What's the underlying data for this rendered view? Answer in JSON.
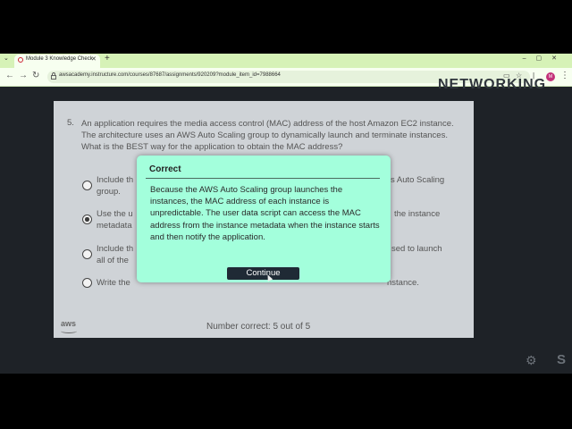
{
  "browser": {
    "tab_title": "Module 3 Knowledge Check",
    "url": "awsacademy.instructure.com/courses/87687/assignments/920209?module_item_id=7988664",
    "avatar_initials": "M",
    "icons": [
      "tab-menu-icon",
      "favicon-icon",
      "close-icon",
      "new-tab-icon",
      "minimize-icon",
      "maximize-icon",
      "window-close-icon",
      "back-icon",
      "forward-icon",
      "reload-icon",
      "lock-icon",
      "install-icon",
      "star-icon",
      "kebab-menu-icon"
    ]
  },
  "watermark": "NETWORKING",
  "question": {
    "number": "5.",
    "text": "An application requires the media access control (MAC) address of the host Amazon EC2 instance. The architecture uses an AWS Auto Scaling group to dynamically launch and terminate instances. What is the BEST way for the application to obtain the MAC address?",
    "options": [
      {
        "left": "Include th",
        "line2": "group.",
        "right": "s Auto Scaling",
        "selected": false
      },
      {
        "left": "Use the u",
        "line2": "metadata",
        "right": "the instance",
        "selected": true
      },
      {
        "left": "Include th",
        "line2": "all of the",
        "right": "sed to launch",
        "selected": false
      },
      {
        "left": "Write the",
        "line2": "",
        "right": "nstance.",
        "selected": false
      }
    ]
  },
  "footer": {
    "logo": "aws",
    "score": "Number correct: 5 out of 5"
  },
  "modal": {
    "title": "Correct",
    "body": "Because the AWS Auto Scaling group launches the instances, the MAC address of each instance is unpredictable. The user data script can access the MAC address from the instance metadata when the instance starts and then notify the application.",
    "button": "Continue"
  },
  "corner_mark": "S"
}
